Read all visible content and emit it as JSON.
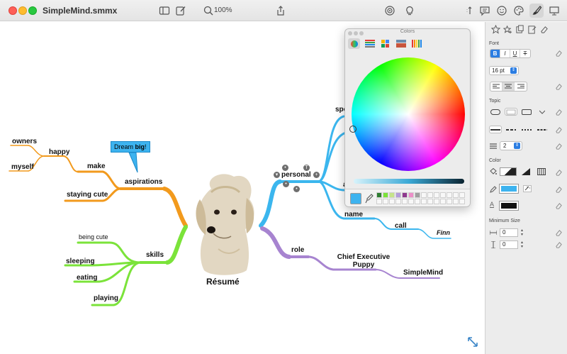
{
  "window": {
    "title": "SimpleMind.smmx",
    "zoom_label": "100%"
  },
  "mindmap": {
    "central": "Résumé",
    "callout": {
      "text_plain": "Dream ",
      "text_bold": "big",
      "text_end": "!"
    },
    "branches": {
      "aspirations": {
        "label": "aspirations",
        "color": "#f29a1d",
        "children": [
          "make",
          "happy",
          "owners",
          "myself",
          "staying cute"
        ]
      },
      "skills": {
        "label": "skills",
        "color": "#7be33a",
        "children": [
          "being cute",
          "sleeping",
          "eating",
          "playing"
        ]
      },
      "personal": {
        "label": "personal",
        "color": "#3bb6ee",
        "children": [
          "spe",
          "a",
          "name",
          "call",
          "Finn"
        ]
      },
      "role": {
        "label": "role",
        "color": "#a784d0",
        "children": [
          "Chief Executive Puppy",
          "SimpleMind"
        ]
      }
    }
  },
  "colors_panel": {
    "title": "Colors",
    "tabs": [
      "color-wheel",
      "color-sliders",
      "color-palettes",
      "image-palettes",
      "pencils"
    ],
    "current_color": "#3db3ef"
  },
  "inspector": {
    "sections": {
      "font": "Font",
      "topic": "Topic",
      "color": "Color",
      "min_size": "Minimum Size"
    },
    "font_buttons": [
      "B",
      "I",
      "U",
      "T"
    ],
    "font_size": "16 pt",
    "line_width": "2",
    "min_width": "0",
    "min_height": "0",
    "topic_fill_color": "#3db3ef",
    "text_color": "#111111"
  }
}
